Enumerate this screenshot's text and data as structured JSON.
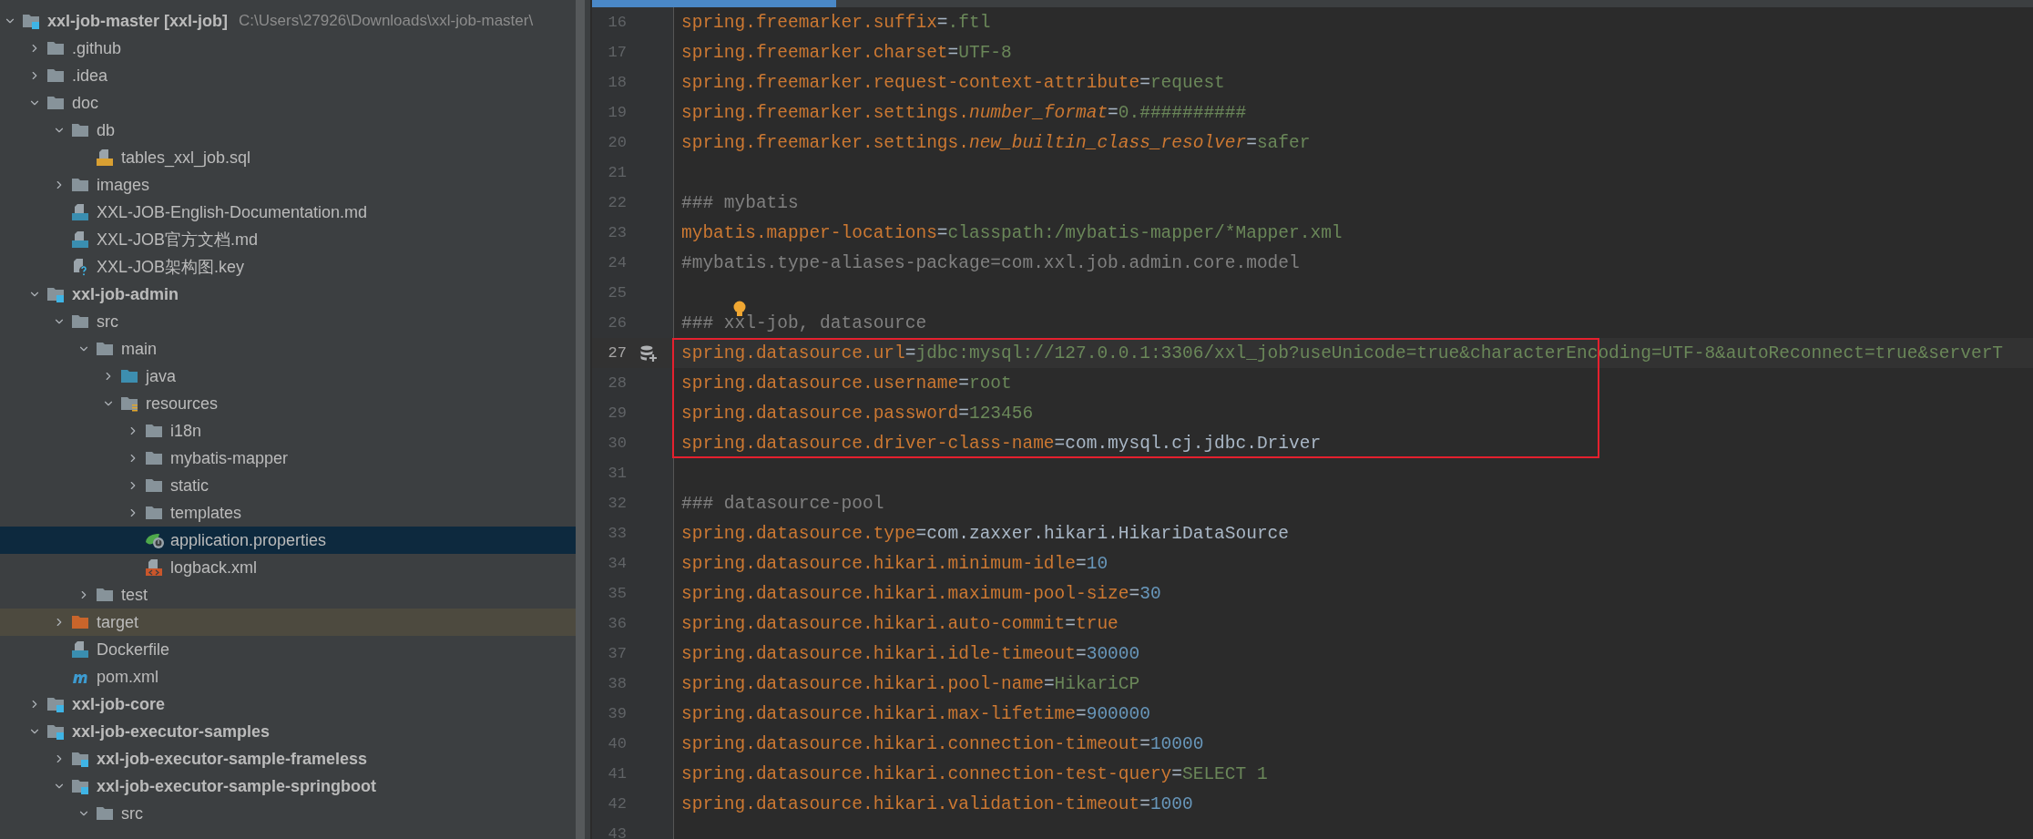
{
  "project_tree": {
    "items": [
      {
        "label": "xxl-job-master **[xxl-job]**",
        "path": "C:\\Users\\27926\\Downloads\\xxl-job-master\\",
        "kind": "module",
        "expanded": true,
        "selected": false,
        "children": [
          {
            "label": ".github",
            "kind": "folder",
            "expanded": false,
            "selected": false
          },
          {
            "label": ".idea",
            "kind": "folder",
            "expanded": false,
            "selected": false
          },
          {
            "label": "doc",
            "kind": "folder",
            "expanded": true,
            "selected": false,
            "children": [
              {
                "label": "db",
                "kind": "folder",
                "expanded": true,
                "selected": false,
                "children": [
                  {
                    "label": "tables_xxl_job.sql",
                    "kind": "sql",
                    "selected": false
                  }
                ]
              },
              {
                "label": "images",
                "kind": "folder",
                "expanded": false,
                "selected": false
              },
              {
                "label": "XXL-JOB-English-Documentation.md",
                "kind": "markdown",
                "selected": false
              },
              {
                "label": "XXL-JOB官方文档.md",
                "kind": "markdown",
                "selected": false
              },
              {
                "label": "XXL-JOB架构图.key",
                "kind": "unknown",
                "selected": false
              }
            ]
          },
          {
            "label": "xxl-job-admin",
            "kind": "module",
            "expanded": true,
            "selected": false,
            "children": [
              {
                "label": "src",
                "kind": "folder",
                "expanded": true,
                "selected": false,
                "children": [
                  {
                    "label": "main",
                    "kind": "folder",
                    "expanded": true,
                    "selected": false,
                    "children": [
                      {
                        "label": "java",
                        "kind": "source_folder",
                        "expanded": false,
                        "selected": false
                      },
                      {
                        "label": "resources",
                        "kind": "resources_folder",
                        "expanded": true,
                        "selected": false,
                        "children": [
                          {
                            "label": "i18n",
                            "kind": "folder",
                            "expanded": false,
                            "selected": false
                          },
                          {
                            "label": "mybatis-mapper",
                            "kind": "folder",
                            "expanded": false,
                            "selected": false
                          },
                          {
                            "label": "static",
                            "kind": "folder",
                            "expanded": false,
                            "selected": false
                          },
                          {
                            "label": "templates",
                            "kind": "folder",
                            "expanded": false,
                            "selected": false
                          },
                          {
                            "label": "application.properties",
                            "kind": "properties",
                            "selected": true
                          },
                          {
                            "label": "logback.xml",
                            "kind": "xml",
                            "selected": false
                          }
                        ]
                      }
                    ]
                  },
                  {
                    "label": "test",
                    "kind": "folder",
                    "expanded": false,
                    "selected": false
                  }
                ]
              },
              {
                "label": "target",
                "kind": "excluded_folder",
                "expanded": false,
                "selected": false
              },
              {
                "label": "Dockerfile",
                "kind": "docker",
                "selected": false
              },
              {
                "label": "pom.xml",
                "kind": "maven",
                "selected": false
              }
            ]
          },
          {
            "label": "xxl-job-core",
            "kind": "module",
            "expanded": false,
            "selected": false
          },
          {
            "label": "xxl-job-executor-samples",
            "kind": "module",
            "expanded": true,
            "selected": false,
            "children": [
              {
                "label": "xxl-job-executor-sample-frameless",
                "kind": "module",
                "expanded": false,
                "selected": false
              },
              {
                "label": "xxl-job-executor-sample-springboot",
                "kind": "module",
                "expanded": true,
                "selected": false,
                "children": [
                  {
                    "label": "src",
                    "kind": "folder",
                    "expanded": true,
                    "selected": false
                  }
                ]
              }
            ]
          }
        ]
      }
    ]
  },
  "editor": {
    "lines": [
      {
        "number": "16",
        "current": false,
        "boxed": false,
        "segments": [
          {
            "kind": "key",
            "text": "spring.freemarker.suffix"
          },
          {
            "kind": "eq",
            "text": "="
          },
          {
            "kind": "value",
            "text": ".ftl"
          }
        ]
      },
      {
        "number": "17",
        "current": false,
        "boxed": false,
        "gutter_marker": false,
        "intention_bulb": false,
        "segments": [
          {
            "kind": "key",
            "text": "spring.freemarker.charset"
          },
          {
            "kind": "eq",
            "text": "="
          },
          {
            "kind": "value",
            "text": "UTF-8"
          }
        ]
      },
      {
        "number": "18",
        "current": false,
        "boxed": false,
        "gutter_marker": false,
        "intention_bulb": false,
        "segments": [
          {
            "kind": "key",
            "text": "spring.freemarker.request-context-attribute"
          },
          {
            "kind": "eq",
            "text": "="
          },
          {
            "kind": "value",
            "text": "request"
          }
        ]
      },
      {
        "number": "19",
        "current": false,
        "boxed": false,
        "gutter_marker": false,
        "intention_bulb": false,
        "segments": [
          {
            "kind": "key",
            "text": "spring.freemarker.settings."
          },
          {
            "kind": "key_italic",
            "text": "number_format"
          },
          {
            "kind": "eq",
            "text": "="
          },
          {
            "kind": "value",
            "text": "0.##########"
          }
        ]
      },
      {
        "number": "20",
        "current": false,
        "boxed": false,
        "gutter_marker": false,
        "intention_bulb": false,
        "segments": [
          {
            "kind": "key",
            "text": "spring.freemarker.settings."
          },
          {
            "kind": "key_italic",
            "text": "new_builtin_class_resolver"
          },
          {
            "kind": "eq",
            "text": "="
          },
          {
            "kind": "value",
            "text": "safer"
          }
        ]
      },
      {
        "number": "21",
        "current": false,
        "boxed": false,
        "gutter_marker": false,
        "intention_bulb": false
      },
      {
        "number": "22",
        "current": false,
        "boxed": false,
        "gutter_marker": false,
        "intention_bulb": false,
        "segments": [
          {
            "kind": "comment",
            "text": "### mybatis"
          }
        ]
      },
      {
        "number": "23",
        "current": false,
        "boxed": false,
        "gutter_marker": false,
        "intention_bulb": false,
        "segments": [
          {
            "kind": "key",
            "text": "mybatis.mapper-locations"
          },
          {
            "kind": "eq",
            "text": "="
          },
          {
            "kind": "value",
            "text": "classpath:/mybatis-mapper/*Mapper.xml"
          }
        ]
      },
      {
        "number": "24",
        "current": false,
        "boxed": false,
        "gutter_marker": false,
        "intention_bulb": false,
        "segments": [
          {
            "kind": "comment",
            "text": "#mybatis.type-aliases-package=com.xxl.job.admin.core.model"
          }
        ]
      },
      {
        "number": "25",
        "current": false,
        "boxed": false,
        "gutter_marker": false,
        "intention_bulb": false
      },
      {
        "number": "26",
        "current": false,
        "boxed": false,
        "gutter_marker": false,
        "intention_bulb": true,
        "segments": [
          {
            "kind": "comment",
            "text": "### xxl-job, datasource"
          }
        ]
      },
      {
        "number": "27",
        "current": true,
        "boxed": true,
        "gutter_marker": true,
        "intention_bulb": false,
        "segments": [
          {
            "kind": "key",
            "text": "spring.datasource.url"
          },
          {
            "kind": "eq",
            "text": "="
          },
          {
            "kind": "value",
            "text": "jdbc:mysql://127.0.0.1:3306/xxl_job?useUnicode=true&characterEncoding=UTF-8&autoReconnect=true&serverT"
          }
        ]
      },
      {
        "number": "28",
        "current": false,
        "boxed": true,
        "gutter_marker": false,
        "intention_bulb": false,
        "segments": [
          {
            "kind": "key",
            "text": "spring.datasource.username"
          },
          {
            "kind": "eq",
            "text": "="
          },
          {
            "kind": "value",
            "text": "root"
          }
        ]
      },
      {
        "number": "29",
        "current": false,
        "boxed": true,
        "gutter_marker": false,
        "intention_bulb": false,
        "segments": [
          {
            "kind": "key",
            "text": "spring.datasource.password"
          },
          {
            "kind": "eq",
            "text": "="
          },
          {
            "kind": "value",
            "text": "123456"
          }
        ]
      },
      {
        "number": "30",
        "current": false,
        "boxed": true,
        "gutter_marker": false,
        "intention_bulb": false,
        "segments": [
          {
            "kind": "key",
            "text": "spring.datasource.driver-class-name"
          },
          {
            "kind": "eq",
            "text": "="
          },
          {
            "kind": "classref",
            "text": "com.mysql.cj.jdbc.Driver"
          }
        ]
      },
      {
        "number": "31",
        "current": false,
        "boxed": false,
        "gutter_marker": false,
        "intention_bulb": false
      },
      {
        "number": "32",
        "current": false,
        "boxed": false,
        "gutter_marker": false,
        "intention_bulb": false,
        "segments": [
          {
            "kind": "comment",
            "text": "### datasource-pool"
          }
        ]
      },
      {
        "number": "33",
        "current": false,
        "boxed": false,
        "gutter_marker": false,
        "intention_bulb": false,
        "segments": [
          {
            "kind": "key",
            "text": "spring.datasource.type"
          },
          {
            "kind": "eq",
            "text": "="
          },
          {
            "kind": "classref",
            "text": "com.zaxxer.hikari.HikariDataSource"
          }
        ]
      },
      {
        "number": "34",
        "current": false,
        "boxed": false,
        "gutter_marker": false,
        "intention_bulb": false,
        "segments": [
          {
            "kind": "key",
            "text": "spring.datasource.hikari.minimum-idle"
          },
          {
            "kind": "eq",
            "text": "="
          },
          {
            "kind": "number",
            "text": "10"
          }
        ]
      },
      {
        "number": "35",
        "current": false,
        "boxed": false,
        "gutter_marker": false,
        "intention_bulb": false,
        "segments": [
          {
            "kind": "key",
            "text": "spring.datasource.hikari.maximum-pool-size"
          },
          {
            "kind": "eq",
            "text": "="
          },
          {
            "kind": "number",
            "text": "30"
          }
        ]
      },
      {
        "number": "36",
        "current": false,
        "boxed": false,
        "gutter_marker": false,
        "intention_bulb": false,
        "segments": [
          {
            "kind": "key",
            "text": "spring.datasource.hikari.auto-commit"
          },
          {
            "kind": "eq",
            "text": "="
          },
          {
            "kind": "keyword",
            "text": "true"
          }
        ]
      },
      {
        "number": "37",
        "current": false,
        "boxed": false,
        "gutter_marker": false,
        "intention_bulb": false,
        "segments": [
          {
            "kind": "key",
            "text": "spring.datasource.hikari.idle-timeout"
          },
          {
            "kind": "eq",
            "text": "="
          },
          {
            "kind": "number",
            "text": "30000"
          }
        ]
      },
      {
        "number": "38",
        "current": false,
        "boxed": false,
        "gutter_marker": false,
        "intention_bulb": false,
        "segments": [
          {
            "kind": "key",
            "text": "spring.datasource.hikari.pool-name"
          },
          {
            "kind": "eq",
            "text": "="
          },
          {
            "kind": "value",
            "text": "HikariCP"
          }
        ]
      },
      {
        "number": "39",
        "current": false,
        "boxed": false,
        "gutter_marker": false,
        "intention_bulb": false,
        "segments": [
          {
            "kind": "key",
            "text": "spring.datasource.hikari.max-lifetime"
          },
          {
            "kind": "eq",
            "text": "="
          },
          {
            "kind": "number",
            "text": "900000"
          }
        ]
      },
      {
        "number": "40",
        "current": false,
        "boxed": false,
        "gutter_marker": false,
        "intention_bulb": false,
        "segments": [
          {
            "kind": "key",
            "text": "spring.datasource.hikari.connection-timeout"
          },
          {
            "kind": "eq",
            "text": "="
          },
          {
            "kind": "number",
            "text": "10000"
          }
        ]
      },
      {
        "number": "41",
        "current": false,
        "boxed": false,
        "gutter_marker": false,
        "intention_bulb": false,
        "segments": [
          {
            "kind": "key",
            "text": "spring.datasource.hikari.connection-test-query"
          },
          {
            "kind": "eq",
            "text": "="
          },
          {
            "kind": "value",
            "text": "SELECT 1"
          }
        ]
      },
      {
        "number": "42",
        "current": false,
        "boxed": false,
        "gutter_marker": false,
        "intention_bulb": false,
        "segments": [
          {
            "kind": "key",
            "text": "spring.datasource.hikari.validation-timeout"
          },
          {
            "kind": "eq",
            "text": "="
          },
          {
            "kind": "number",
            "text": "1000"
          }
        ]
      },
      {
        "number": "43",
        "current": false,
        "boxed": false,
        "gutter_marker": false,
        "intention_bulb": false
      }
    ]
  }
}
